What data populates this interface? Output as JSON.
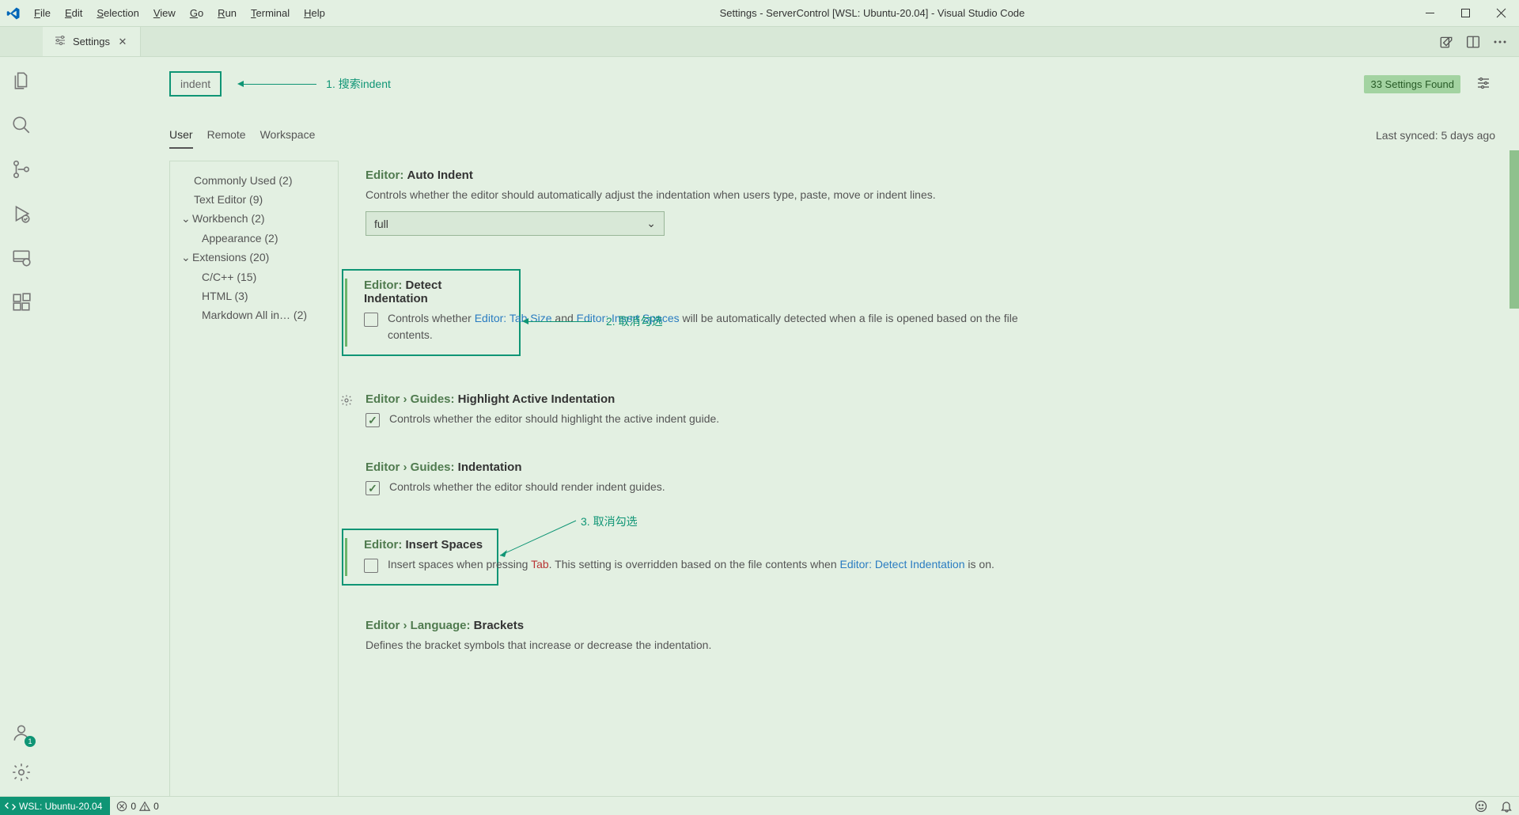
{
  "window": {
    "title": "Settings - ServerControl [WSL: Ubuntu-20.04] - Visual Studio Code"
  },
  "menu": {
    "file": "File",
    "edit": "Edit",
    "selection": "Selection",
    "view": "View",
    "go": "Go",
    "run": "Run",
    "terminal": "Terminal",
    "help": "Help"
  },
  "tab": {
    "label": "Settings"
  },
  "search": {
    "value": "indent",
    "results_badge": "33 Settings Found"
  },
  "annotations": {
    "a1": "1. 搜索indent",
    "a2": "2. 取消勾选",
    "a3": "3. 取消勾选"
  },
  "scope": {
    "user": "User",
    "remote": "Remote",
    "workspace": "Workspace",
    "last_synced": "Last synced: 5 days ago"
  },
  "toc": {
    "commonly_used": "Commonly Used (2)",
    "text_editor": "Text Editor (9)",
    "workbench": "Workbench (2)",
    "appearance": "Appearance (2)",
    "extensions": "Extensions (20)",
    "cpp": "C/C++ (15)",
    "html": "HTML (3)",
    "markdown": "Markdown All in… (2)"
  },
  "settings": {
    "auto_indent": {
      "prefix": "Editor:",
      "name": "Auto Indent",
      "desc": "Controls whether the editor should automatically adjust the indentation when users type, paste, move or indent lines.",
      "value": "full"
    },
    "detect_indentation": {
      "prefix": "Editor:",
      "name": "Detect Indentation",
      "desc_pre": "Controls whether ",
      "link1": "Editor: Tab Size",
      "mid": " and ",
      "link2": "Editor: Insert Spaces",
      "desc_post": " will be automatically detected when a file is opened based on the file contents."
    },
    "highlight_active": {
      "prefix": "Editor › Guides:",
      "name": "Highlight Active Indentation",
      "desc": "Controls whether the editor should highlight the active indent guide."
    },
    "indentation": {
      "prefix": "Editor › Guides:",
      "name": "Indentation",
      "desc": "Controls whether the editor should render indent guides."
    },
    "insert_spaces": {
      "prefix": "Editor:",
      "name": "Insert Spaces",
      "desc_pre": "Insert spaces when pressing ",
      "code": "Tab",
      "desc_mid": ". This setting is overridden based on the file contents when ",
      "link": "Editor: Detect Indentation",
      "desc_post": " is on."
    },
    "brackets": {
      "prefix": "Editor › Language:",
      "name": "Brackets",
      "desc": "Defines the bracket symbols that increase or decrease the indentation."
    }
  },
  "status": {
    "remote": "WSL: Ubuntu-20.04",
    "errors": "0",
    "warnings": "0"
  },
  "accounts_badge": "1"
}
